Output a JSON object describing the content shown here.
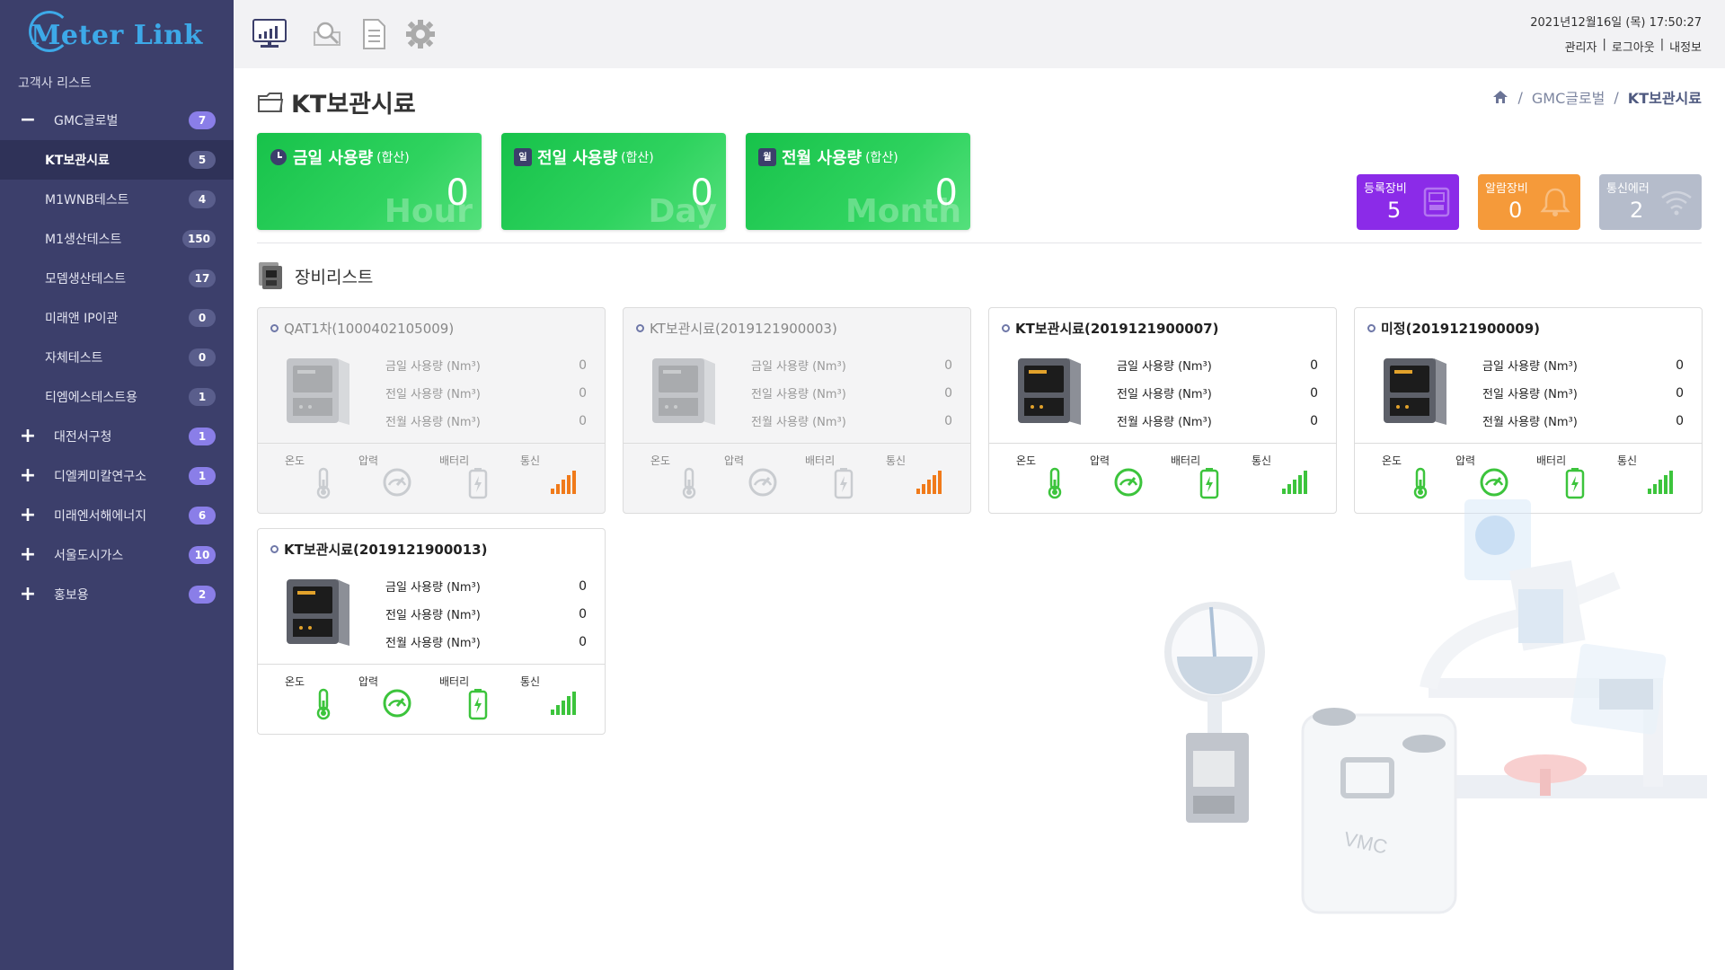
{
  "app": {
    "logo": "Meter Link"
  },
  "sidebar": {
    "title": "고객사 리스트",
    "items": [
      {
        "label": "GMC글로벌",
        "count": "7",
        "sign": "−"
      },
      {
        "label": "KT보관시료",
        "count": "5"
      },
      {
        "label": "M1WNB테스트",
        "count": "4"
      },
      {
        "label": "M1생산테스트",
        "count": "150"
      },
      {
        "label": "모뎀생산테스트",
        "count": "17"
      },
      {
        "label": "미래앤 IP이관",
        "count": "0"
      },
      {
        "label": "자체테스트",
        "count": "0"
      },
      {
        "label": "티엠에스테스트용",
        "count": "1"
      },
      {
        "label": "대전서구청",
        "count": "1",
        "sign": "+"
      },
      {
        "label": "디엘케미칼연구소",
        "count": "1",
        "sign": "+"
      },
      {
        "label": "미래엔서해에너지",
        "count": "6",
        "sign": "+"
      },
      {
        "label": "서울도시가스",
        "count": "10",
        "sign": "+"
      },
      {
        "label": "홍보용",
        "count": "2",
        "sign": "+"
      }
    ]
  },
  "topbar": {
    "icons": [
      "monitor-chart-icon",
      "search-map-icon",
      "document-icon",
      "gear-icon"
    ],
    "datetime": "2021년12월16일 (목) 17:50:27",
    "links": [
      "관리자",
      "로그아웃",
      "내정보"
    ],
    "separator": "|"
  },
  "page": {
    "title": "KT보관시료",
    "breadcrumb": [
      "GMC글로벌",
      "KT보관시료"
    ],
    "breadcrumb_sep": "/"
  },
  "usage": [
    {
      "title": "금일 사용량",
      "sub": "(합산)",
      "value": "0",
      "unit": "Hour",
      "icon_text": ""
    },
    {
      "title": "전일 사용량",
      "sub": "(합산)",
      "value": "0",
      "unit": "Day",
      "icon_text": "일"
    },
    {
      "title": "전월 사용량",
      "sub": "(합산)",
      "value": "0",
      "unit": "Month",
      "icon_text": "월"
    }
  ],
  "stats": [
    {
      "label": "등록장비",
      "value": "5",
      "color": "#8b2be8"
    },
    {
      "label": "알람장비",
      "value": "0",
      "color": "#f59a3a"
    },
    {
      "label": "통신에러",
      "value": "2",
      "color": "#b5bccb"
    }
  ],
  "device_list": {
    "title": "장비리스트",
    "row_labels": [
      "금일 사용량 (Nm³)",
      "전일 사용량 (Nm³)",
      "전월 사용량 (Nm³)"
    ],
    "sensor_labels": [
      "온도",
      "압력",
      "배터리",
      "통신"
    ],
    "devices": [
      {
        "name": "QAT1차(1000402105009)",
        "values": [
          "0",
          "0",
          "0"
        ],
        "status": "inactive"
      },
      {
        "name": "KT보관시료(2019121900003)",
        "values": [
          "0",
          "0",
          "0"
        ],
        "status": "inactive"
      },
      {
        "name": "KT보관시료(2019121900007)",
        "values": [
          "0",
          "0",
          "0"
        ],
        "status": "active"
      },
      {
        "name": "미정(2019121900009)",
        "values": [
          "0",
          "0",
          "0"
        ],
        "status": "active"
      },
      {
        "name": "KT보관시료(2019121900013)",
        "values": [
          "0",
          "0",
          "0"
        ],
        "status": "active"
      }
    ]
  },
  "illustration": {
    "label": "VMC"
  },
  "colors": {
    "sidebar_bg": "#3c3f6b",
    "badge": "#8a7ee8",
    "usage_green": "#22c853",
    "sensor_green": "#3cc43c",
    "signal_orange": "#f07a1a"
  }
}
